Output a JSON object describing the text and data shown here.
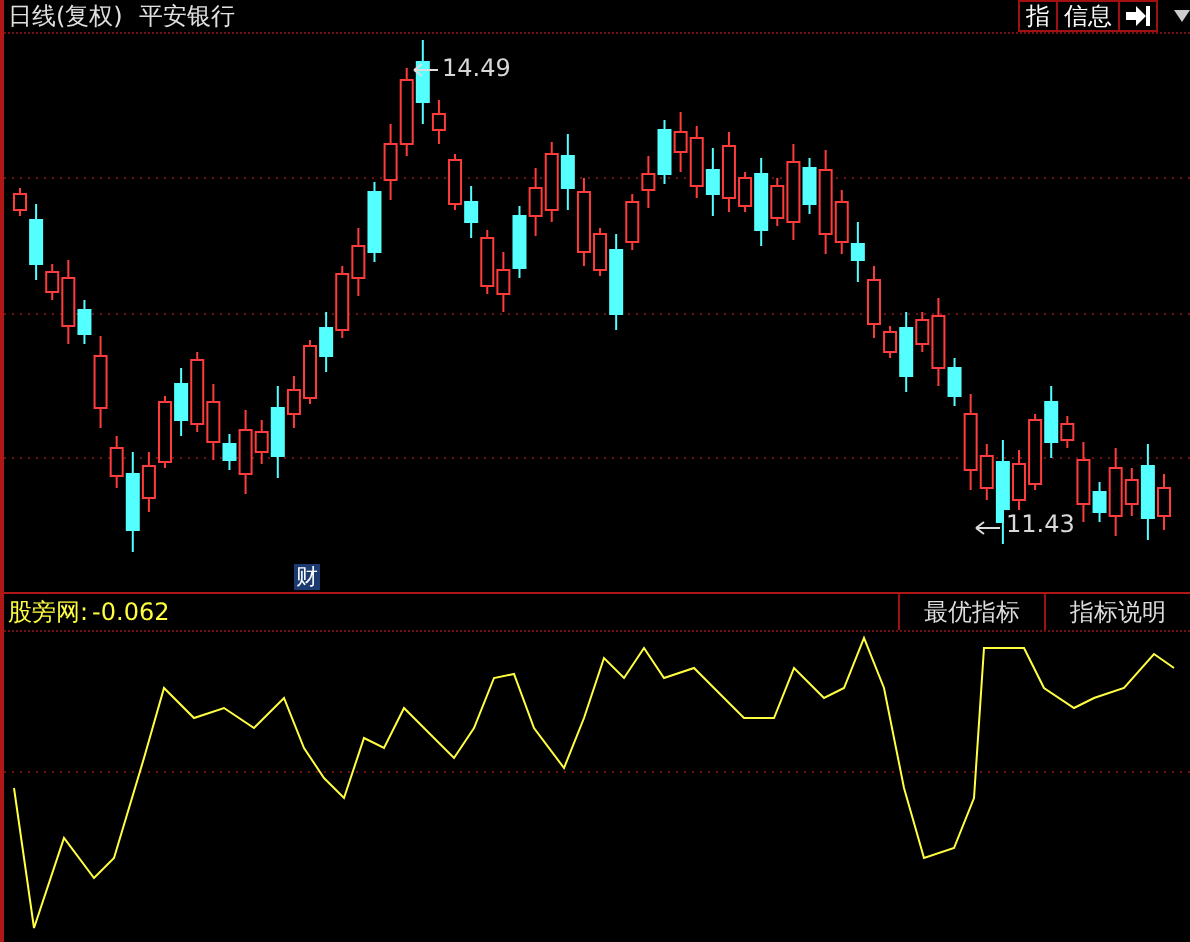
{
  "header": {
    "period": "日线(复权)",
    "stock_name": "平安银行",
    "toolbar_buttons": [
      "指",
      "信息"
    ]
  },
  "price_chart": {
    "high_label": "14.49",
    "low_label": "11.43",
    "marker": "财"
  },
  "indicator_panel": {
    "name": "股旁网:",
    "value": "-0.062",
    "tabs": [
      {
        "label": "最优指标"
      },
      {
        "label": "指标说明"
      }
    ]
  }
}
